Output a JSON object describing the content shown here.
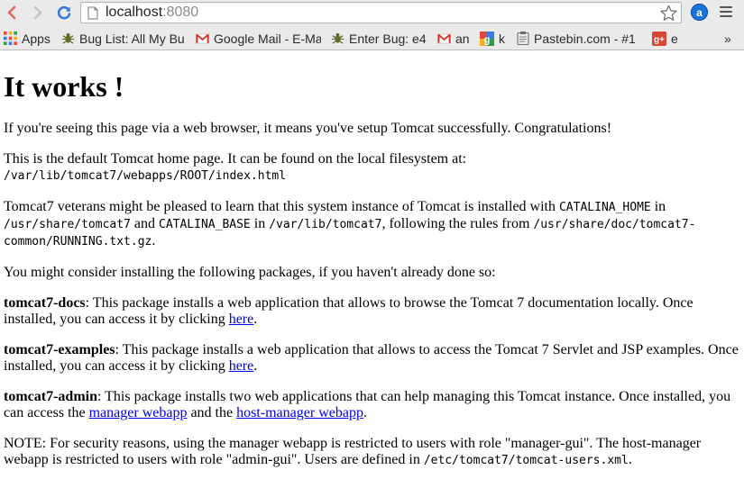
{
  "browser": {
    "url_host": "localhost",
    "url_port": ":8080",
    "extension_label": "a",
    "bookmarks": [
      {
        "label": "Apps",
        "icon": "apps-grid-icon"
      },
      {
        "label": "Bug List: All My Bu",
        "icon": "bug-icon"
      },
      {
        "label": "Google Mail - E-Ma",
        "icon": "gmail-icon"
      },
      {
        "label": "Enter Bug: e4",
        "icon": "bug-icon"
      },
      {
        "label": "an",
        "icon": "gmail-icon"
      },
      {
        "label": "k",
        "icon": "google-icon"
      },
      {
        "label": "Pastebin.com - #1",
        "icon": "pastebin-icon"
      },
      {
        "label": "e",
        "icon": "google-plus-icon"
      }
    ],
    "overflow_label": "»"
  },
  "page": {
    "heading": "It works !",
    "p1": "If you're seeing this page via a web browser, it means you've setup Tomcat successfully. Congratulations!",
    "p2_text": "This is the default Tomcat home page. It can be found on the local filesystem at:",
    "p2_path": "/var/lib/tomcat7/webapps/ROOT/index.html",
    "p3": {
      "t1": "Tomcat7 veterans might be pleased to learn that this system instance of Tomcat is installed with ",
      "c1": "CATALINA_HOME",
      "t2": " in ",
      "c2": "/usr/share/tomcat7",
      "t3": " and ",
      "c3": "CATALINA_BASE",
      "t4": " in ",
      "c4": "/var/lib/tomcat7",
      "t5": ", following the rules from ",
      "c5": "/usr/share/doc/tomcat7-common/RUNNING.txt.gz",
      "t6": "."
    },
    "p4": "You might consider installing the following packages, if you haven't already done so:",
    "docs": {
      "name": "tomcat7-docs",
      "text": ": This package installs a web application that allows to browse the Tomcat 7 documentation locally. Once installed, you can access it by clicking ",
      "link": "here",
      "end": "."
    },
    "examples": {
      "name": "tomcat7-examples",
      "text": ": This package installs a web application that allows to access the Tomcat 7 Servlet and JSP examples. Once installed, you can access it by clicking ",
      "link": "here",
      "end": "."
    },
    "admin": {
      "name": "tomcat7-admin",
      "text": ": This package installs two web applications that can help managing this Tomcat instance. Once installed, you can access the ",
      "link1": "manager webapp",
      "mid": " and the ",
      "link2": "host-manager webapp",
      "end": "."
    },
    "note": {
      "text": "NOTE: For security reasons, using the manager webapp is restricted to users with role \"manager-gui\". The host-manager webapp is restricted to users with role \"admin-gui\". Users are defined in ",
      "path": "/etc/tomcat7/tomcat-users.xml",
      "end": "."
    }
  }
}
